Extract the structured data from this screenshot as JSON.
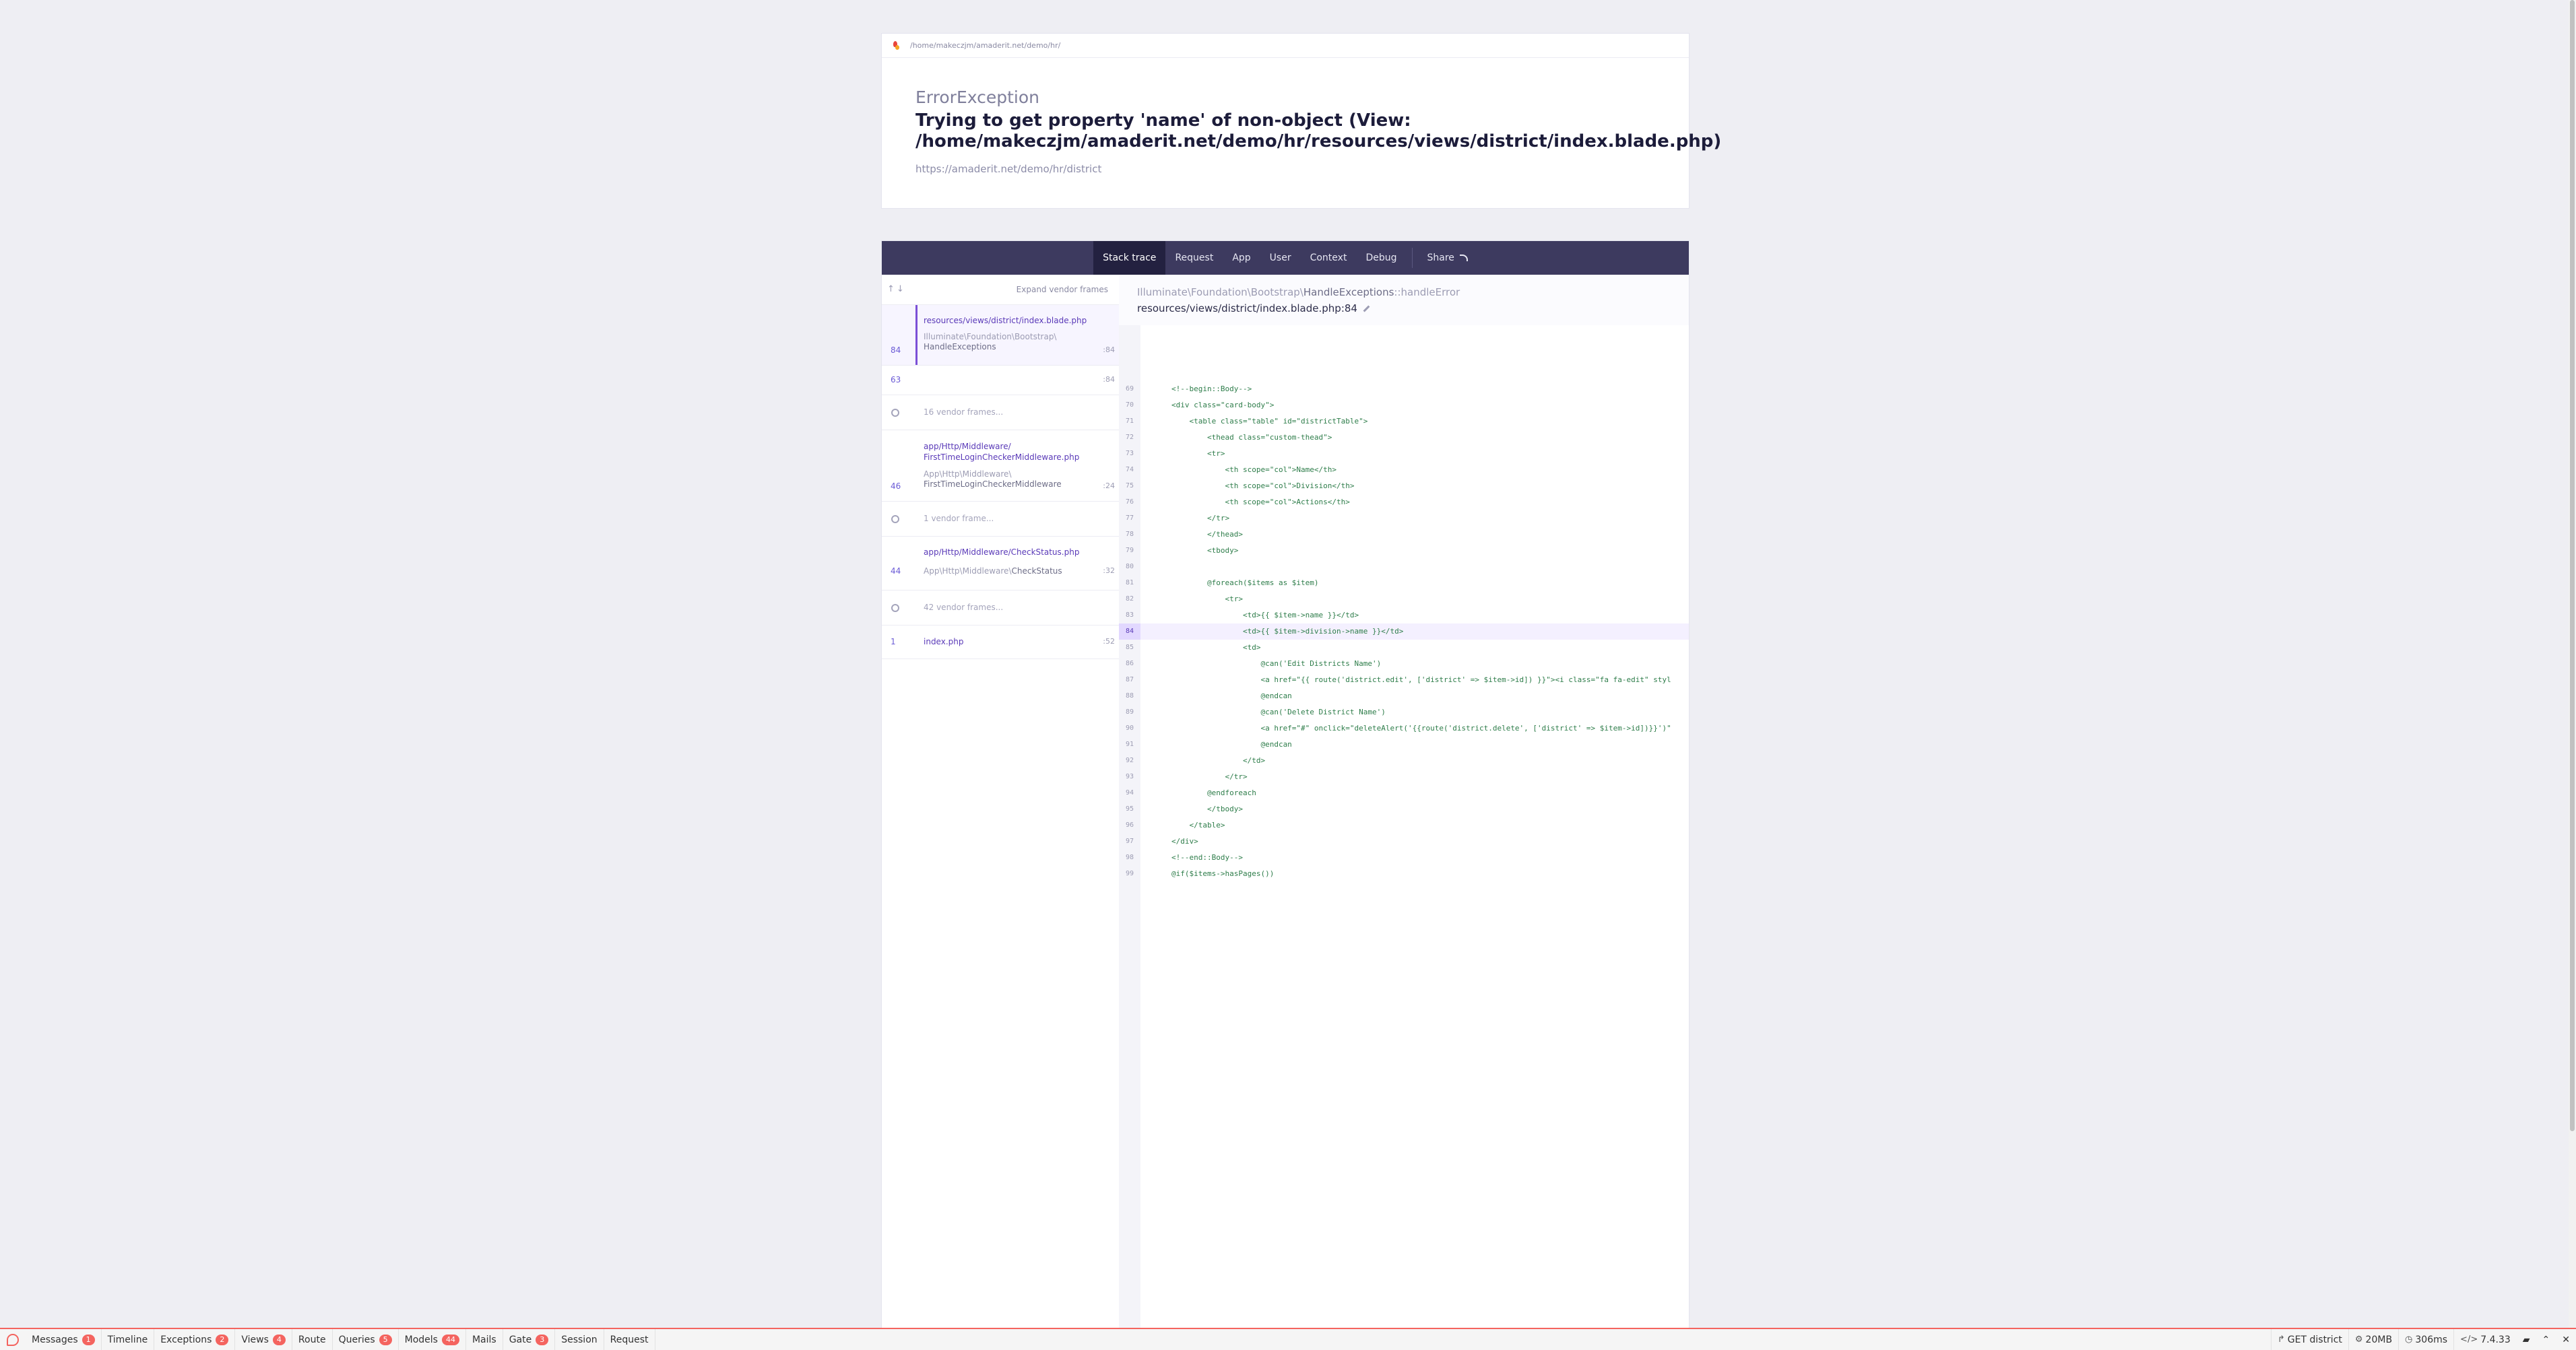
{
  "header": {
    "path": "/home/makeczjm/amaderit.net/demo/hr/",
    "exception_class": "ErrorException",
    "message": "Trying to get property 'name' of non-object (View: /home/makeczjm/amaderit.net/demo/hr/resources/views/district/index.blade.php)",
    "url": "https://amaderit.net/demo/hr/district"
  },
  "tabs": [
    {
      "label": "Stack trace"
    },
    {
      "label": "Request"
    },
    {
      "label": "App"
    },
    {
      "label": "User"
    },
    {
      "label": "Context"
    },
    {
      "label": "Debug"
    }
  ],
  "share_label": "Share",
  "expand_vendor_label": "Expand vendor frames",
  "frames": [
    {
      "file": "resources/views/district/index.blade.php",
      "class_ns": "Illuminate\\Foundation\\Bootstrap\\",
      "class_name": "HandleExceptions",
      "line_left": "84",
      "line_right": ":84"
    },
    {
      "line_left": "63",
      "line_right": ":84"
    },
    {
      "vendor_label": "16 vendor frames..."
    },
    {
      "file_ns": "app/Http/Middleware/",
      "file_name": "FirstTimeLoginCheckerMiddleware.php",
      "class_ns": "App\\Http\\Middleware\\",
      "class_name": "FirstTimeLoginCheckerMiddleware",
      "line_left": "46",
      "line_right": ":24"
    },
    {
      "vendor_label": "1 vendor frame..."
    },
    {
      "file": "app/Http/Middleware/CheckStatus.php",
      "class_ns": "App\\Http\\Middleware\\",
      "class_name": "CheckStatus",
      "line_left": "44",
      "line_right": ":32"
    },
    {
      "vendor_label": "42 vendor frames..."
    },
    {
      "file": "index.php",
      "line_left": "1",
      "line_right": ":52"
    }
  ],
  "code": {
    "class_ns": "Illuminate\\Foundation\\Bootstrap\\",
    "class_name": "HandleExceptions",
    "method": "::handleError",
    "file": "resources/views/district/index.blade.php:84",
    "highlight_line": "84",
    "lines": [
      {
        "n": "69",
        "code": "<!--begin::Body-->"
      },
      {
        "n": "70",
        "code": "<div class=\"card-body\">"
      },
      {
        "n": "71",
        "code": "    <table class=\"table\" id=\"districtTable\">"
      },
      {
        "n": "72",
        "code": "        <thead class=\"custom-thead\">"
      },
      {
        "n": "73",
        "code": "        <tr>"
      },
      {
        "n": "74",
        "code": "            <th scope=\"col\">Name</th>"
      },
      {
        "n": "75",
        "code": "            <th scope=\"col\">Division</th>"
      },
      {
        "n": "76",
        "code": "            <th scope=\"col\">Actions</th>"
      },
      {
        "n": "77",
        "code": "        </tr>"
      },
      {
        "n": "78",
        "code": "        </thead>"
      },
      {
        "n": "79",
        "code": "        <tbody>"
      },
      {
        "n": "80",
        "code": ""
      },
      {
        "n": "81",
        "code": "        @foreach($items as $item)"
      },
      {
        "n": "82",
        "code": "            <tr>"
      },
      {
        "n": "83",
        "code": "                <td>{{ $item->name }}</td>"
      },
      {
        "n": "84",
        "code": "                <td>{{ $item->division->name }}</td>"
      },
      {
        "n": "85",
        "code": "                <td>"
      },
      {
        "n": "86",
        "code": "                    @can('Edit Districts Name')"
      },
      {
        "n": "87",
        "code": "                    <a href=\"{{ route('district.edit', ['district' => $item->id]) }}\"><i class=\"fa fa-edit\" styl"
      },
      {
        "n": "88",
        "code": "                    @endcan"
      },
      {
        "n": "89",
        "code": "                    @can('Delete District Name')"
      },
      {
        "n": "90",
        "code": "                    <a href=\"#\" onclick=\"deleteAlert('{{route('district.delete', ['district' => $item->id])}}')\""
      },
      {
        "n": "91",
        "code": "                    @endcan"
      },
      {
        "n": "92",
        "code": "                </td>"
      },
      {
        "n": "93",
        "code": "            </tr>"
      },
      {
        "n": "94",
        "code": "        @endforeach"
      },
      {
        "n": "95",
        "code": "        </tbody>"
      },
      {
        "n": "96",
        "code": "    </table>"
      },
      {
        "n": "97",
        "code": "</div>"
      },
      {
        "n": "98",
        "code": "<!--end::Body-->"
      },
      {
        "n": "99",
        "code": "@if($items->hasPages())"
      }
    ]
  },
  "debugbar": {
    "items": [
      {
        "label": "Messages",
        "badge": "1"
      },
      {
        "label": "Timeline",
        "badge": ""
      },
      {
        "label": "Exceptions",
        "badge": "2"
      },
      {
        "label": "Views",
        "badge": "4"
      },
      {
        "label": "Route",
        "badge": ""
      },
      {
        "label": "Queries",
        "badge": "5"
      },
      {
        "label": "Models",
        "badge": "44"
      },
      {
        "label": "Mails",
        "badge": ""
      },
      {
        "label": "Gate",
        "badge": "3"
      },
      {
        "label": "Session",
        "badge": ""
      },
      {
        "label": "Request",
        "badge": ""
      }
    ],
    "route": "GET district",
    "memory": "20MB",
    "time": "306ms",
    "php_version": "7.4.33"
  }
}
